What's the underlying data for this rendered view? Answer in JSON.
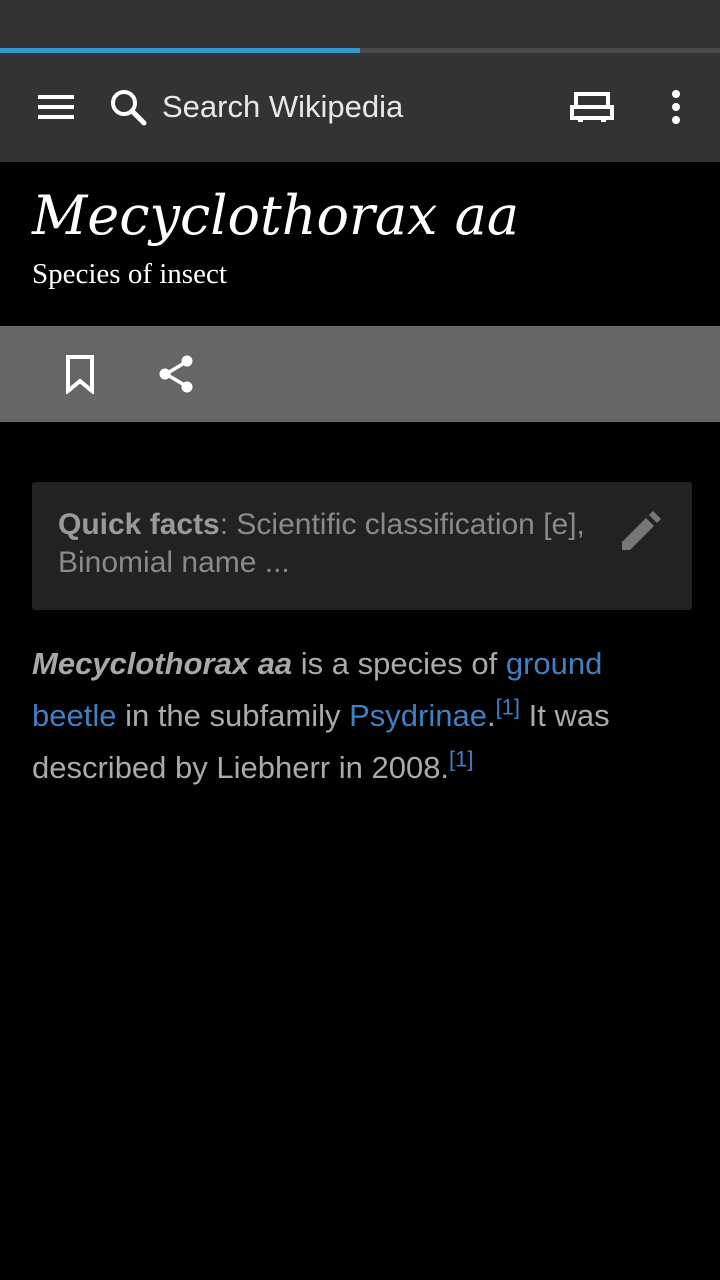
{
  "loading": {
    "progress_percent": 50
  },
  "toolbar": {
    "search_placeholder": "Search Wikipedia",
    "icons": [
      "menu-icon",
      "search-icon",
      "reading-lists-icon",
      "overflow-icon"
    ]
  },
  "article": {
    "title": "Mecyclothorax aa",
    "description": "Species of insect",
    "actions": [
      "bookmark-icon",
      "share-icon"
    ],
    "quick_facts": {
      "label": "Quick facts",
      "separator": ": ",
      "summary": "Scientific classification [e], Binomial name ..."
    },
    "paragraph": {
      "bold_name": "Mecyclothorax aa",
      "text1": " is a species of ",
      "link1": "ground beetle",
      "text2": " in the subfamily ",
      "link2": "Psydrinae",
      "text3": ".",
      "ref1": "[1]",
      "text4": " It was described by Liebherr in 2008.",
      "ref2": "[1]"
    }
  },
  "colors": {
    "progress": "#3399cc",
    "toolbar_bg": "#333333",
    "action_bar_bg": "#666666",
    "link": "#3f7fc2"
  }
}
